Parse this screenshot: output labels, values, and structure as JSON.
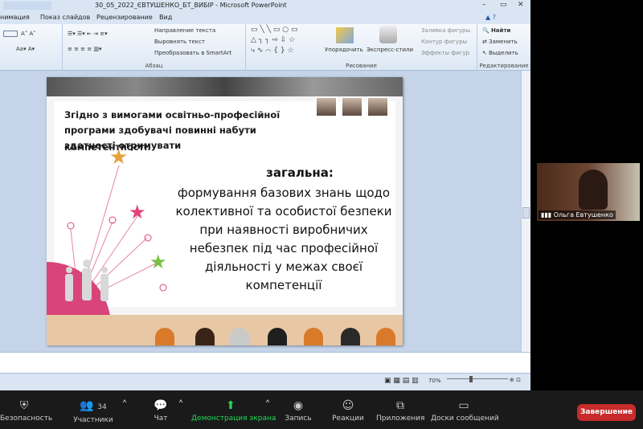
{
  "window": {
    "title": "30_05_2022_ЄВТУШЕНКО_БТ_ВИБІР  -  Microsoft PowerPoint"
  },
  "ribbon_tabs": [
    "нимация",
    "Показ слайдов",
    "Рецензирование",
    "Вид"
  ],
  "ribbon": {
    "paragraph": {
      "label": "Абзац",
      "items": [
        "Направление текста",
        "Выровнять текст",
        "Преобразовать в SmartArt"
      ]
    },
    "drawing": {
      "label": "Рисование",
      "arrange": "Упорядочить",
      "quick_styles": "Экспресс-стили",
      "fill": "Заливка фигуры",
      "outline": "Контур фигуры",
      "effects": "Эффекты фигур"
    },
    "editing": {
      "label": "Редактирование",
      "find": "Найти",
      "replace": "Заменить",
      "select": "Выделить"
    }
  },
  "slide": {
    "intro": "Згідно з вимогами освітньо-професійної програми здобувачі повинні набути здатності отримувати",
    "competence": "компетентності:",
    "heading": "загальна:",
    "body": "формування базових знань щодо колективної та особистої безпеки при наявності виробничих небезпек під час професійної діяльності у межах своєї компетенції"
  },
  "statusbar": {
    "zoom": "70%"
  },
  "video": {
    "participant_name": "Ольга Евтушенко"
  },
  "zoom_toolbar": {
    "security": "Безопасность",
    "participants": "Участники",
    "participants_count": "34",
    "chat": "Чат",
    "share_screen": "Демонстрация экрана",
    "record": "Запись",
    "reactions": "Реакции",
    "apps": "Приложения",
    "whiteboards": "Доски сообщений",
    "end": "Завершение"
  },
  "colors": {
    "accent_green": "#23d959",
    "end_red": "#c72b2b",
    "ribbon_blue": "#d9e5f3"
  }
}
